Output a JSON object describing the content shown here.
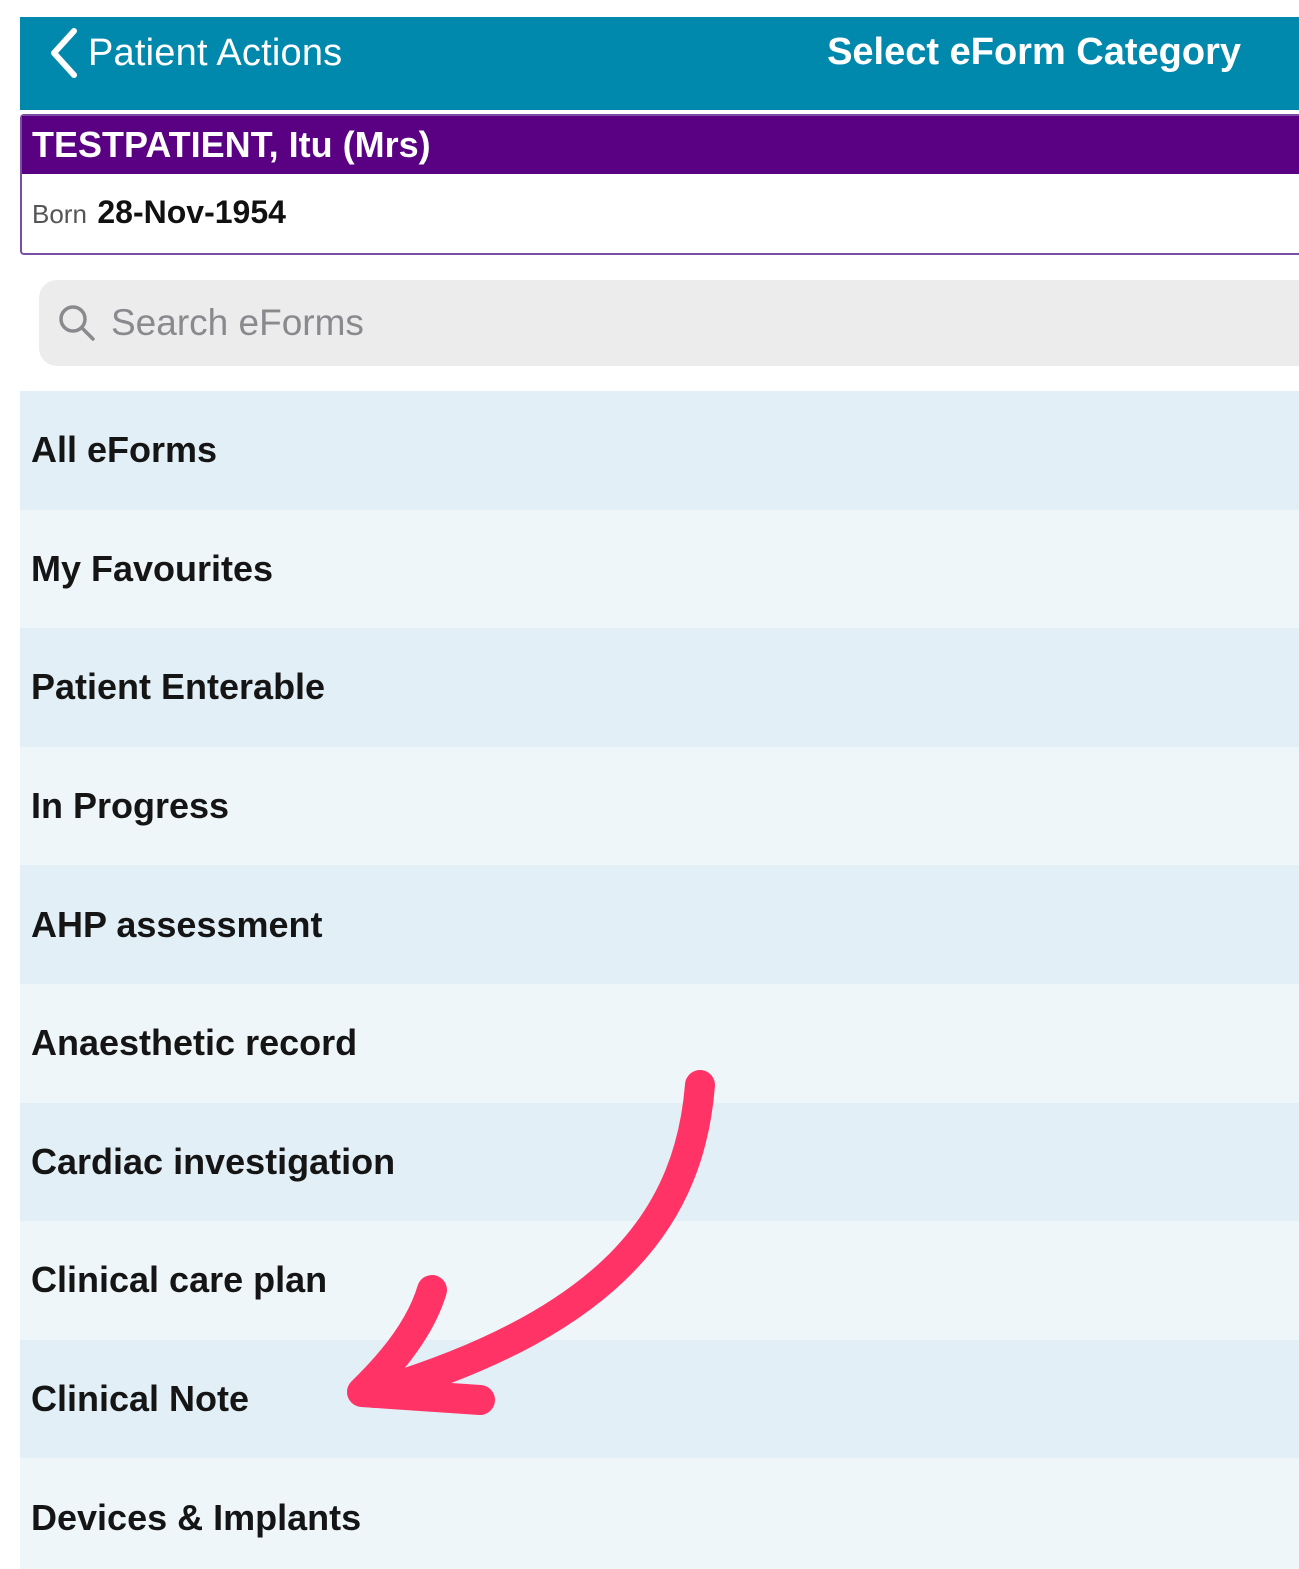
{
  "navbar": {
    "back_label": "Patient Actions",
    "title": "Select eForm Category",
    "background_color": "#0089ad"
  },
  "patient": {
    "name": "TESTPATIENT, Itu (Mrs)",
    "dob_label": "Born",
    "dob_value": "28-Nov-1954",
    "banner_color": "#5a0082"
  },
  "search": {
    "placeholder": "Search eForms",
    "icon": "search-icon"
  },
  "categories": [
    {
      "label": "All eForms"
    },
    {
      "label": "My Favourites"
    },
    {
      "label": "Patient Enterable"
    },
    {
      "label": "In Progress"
    },
    {
      "label": "AHP assessment"
    },
    {
      "label": "Anaesthetic record"
    },
    {
      "label": "Cardiac investigation"
    },
    {
      "label": "Clinical care plan"
    },
    {
      "label": "Clinical Note"
    },
    {
      "label": "Devices & Implants"
    }
  ],
  "annotation": {
    "type": "curved-arrow",
    "points_to": "Clinical Note",
    "color": "#ff3366"
  }
}
